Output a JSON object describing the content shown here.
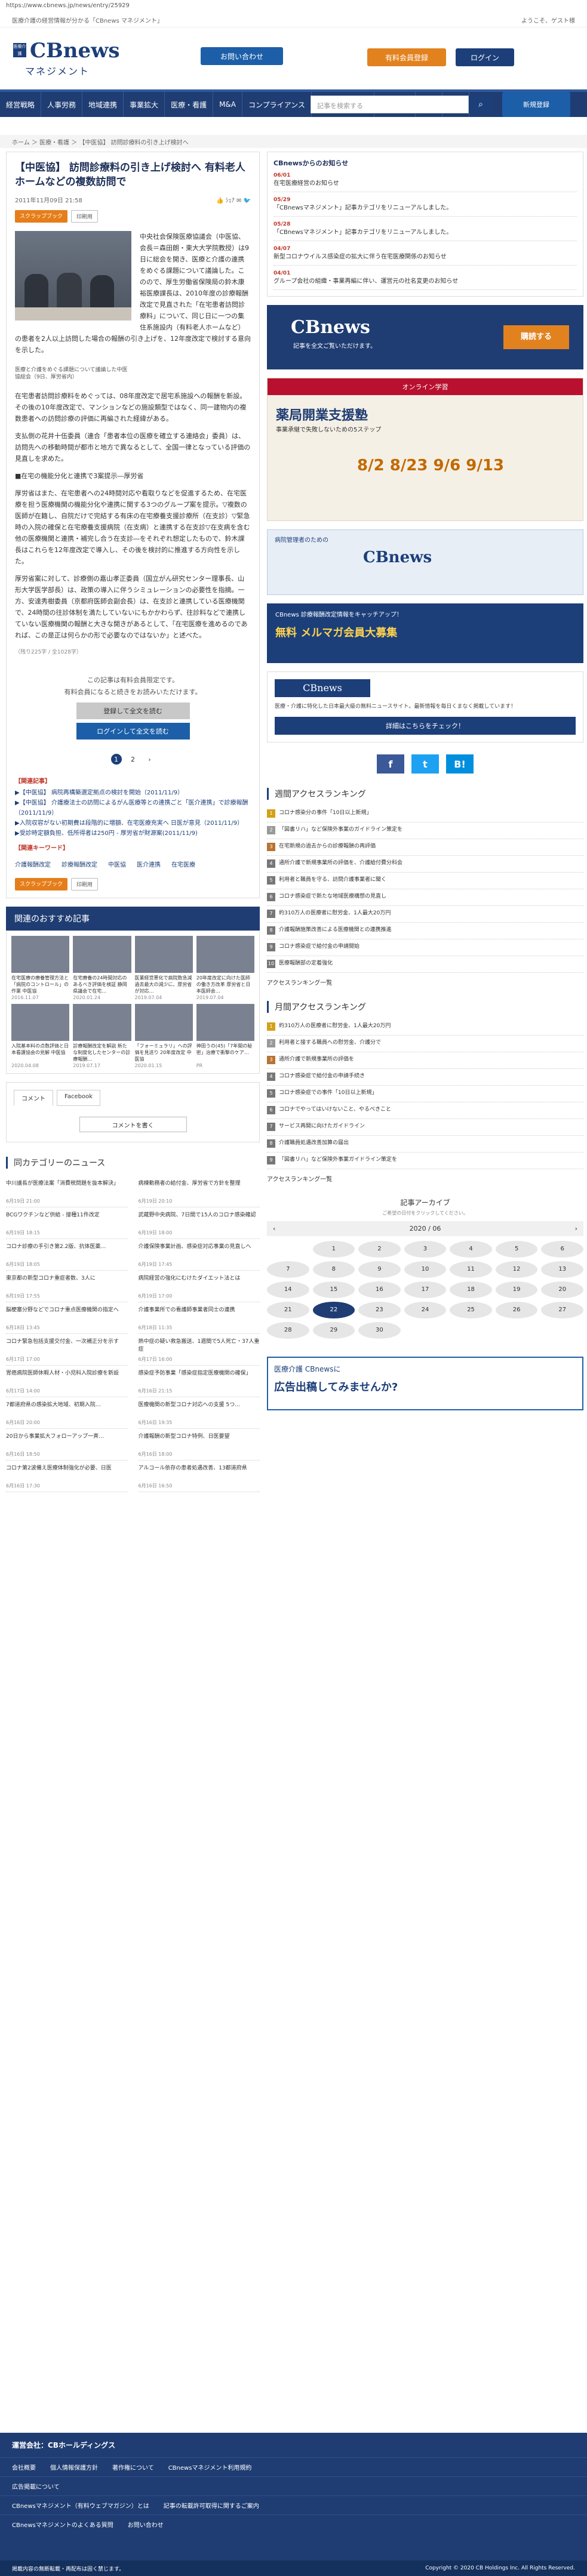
{
  "browser": {
    "url": "https://www.cbnews.jp/news/entry/25929"
  },
  "topstrip": {
    "left": "医療介護の経営情報が分かる「CBnews マネジメント」",
    "right": "ようこそ、ゲスト様"
  },
  "header": {
    "logo_top": "CBnews",
    "logo_bottom": "マネジメント",
    "logo_mark": "医療介護",
    "btn1": "お問い合わせ",
    "btn2": "有料会員登録",
    "btn3": "ログイン"
  },
  "nav": [
    "経営戦略",
    "人事労務",
    "地域連携",
    "事業拡大",
    "医療・看護",
    "M&A",
    "コンプライアンス",
    "イノベーション",
    "世代交代",
    "行政",
    "特集"
  ],
  "search": {
    "placeholder": "記事を検索する",
    "reg_btn": "新規登録"
  },
  "breadcrumb": "ホーム ＞ 医療・看護 ＞ 【中医協】 訪問診療料の引き上げ検討へ",
  "article": {
    "title": "【中医協】 訪問診療料の引き上げ検討へ 有料老人ホームなどの複数訪問で",
    "date": "2011年11月09日 21:58",
    "tag": "スクラップブック",
    "print": "印刷用",
    "caption": "医療と介護をめぐる課題について議論した中医協総会（9日、厚労省内）",
    "p1": "中央社会保険医療協議会（中医協、会長＝森田朗・東大大学院教授）は9日に総会を開き、医療と介護の連携をめぐる課題について議論した。このので、厚生労働省保険局の鈴木康裕医療課長は、2010年度の診療報酬改定で見直された「在宅患者訪問診療料」について、同じ日に一つの集住系施設内（有料老人ホームなど）の患者を2人以上訪問した場合の報酬の引き上げを、12年度改定で検討する意向を示した。",
    "p2": "在宅患者訪問診療料をめぐっては、08年度改定で居宅系施設への報酬を新設。その後の10年度改定で、マンションなどの施設類型ではなく、同一建物内の複数患者への訪問診療の評価に再編された経緯がある。",
    "p3": "支払側の花井十伍委員（連合「患者本位の医療を確立する連絡会」委員）は、訪問先への移動時間が都市と地方で異なるとして、全国一律となっている評価の見直しを求めた。",
    "p4": "■在宅の機能分化と連携で3案提示―厚労省",
    "p5": "厚労省はまた、在宅患者への24時間対応や看取りなどを促進するため、在宅医療を担う医療機関の機能分化や連携に関する3つのグループ案を提示。▽複数の医師が在籍し、自院だけで完結する有床の在宅療養支援診療所（在支診）▽緊急時の入院の確保と在宅療養支援病院（在支病）と連携する在支診▽在支病を含む他の医療機関と連携・補完し合う在支診―をそれぞれ想定したもので、鈴木課長はこれらを12年度改定で導入し、その後を検討的に推進する方向性を示した。",
    "p6": "厚労省案に対して、診療側の嘉山孝正委員（国立がん研究センター理事長、山形大学医学部長）は、政策の導入に伴うシミュレーションの必要性を指摘。一方、安達秀樹委員（京都府医師会副会長）は、在支診と連携している医療機関で、24時間の往診体制を満たしていないにもかかわらず、往診料などで連携していない医療機関の報酬と大きな開きがあるとして、「在宅医療を進めるのであれば、この是正は何らかの形で必要なのではないか」と述べた。",
    "count": "（残り225字 / 全1028字）",
    "lock1": "この記事は有料会員限定です。",
    "lock2": "有料会員になると続きをお読みいただけます。",
    "btn_reg": "登録して全文を読む",
    "btn_login": "ログインして全文を読む",
    "pages": [
      "1",
      "2",
      "›"
    ],
    "related_h": "【関連記事】",
    "related": [
      "▶【中医協】 病院再構築選定拠点の検討を開始（2011/11/9）",
      "▶【中医協】 介護療法士の訪問によるがん医療等との連携ごと「医介連携」で診療報酬（2011/11/9）",
      "▶入院収容がない初期費は段階的に増額、在宅医療充実へ 日医が意見（2011/11/9）",
      "▶受診時定額負担、低所得者は250円 - 厚労省が財源案(2011/11/9)"
    ],
    "kw_h": "【関連キーワード】",
    "keywords": [
      "介護報酬改定",
      "診療報酬改定",
      "中医協",
      "医介連携",
      "在宅医療"
    ]
  },
  "recommend": {
    "title": "関連のおすすめ記事",
    "items": [
      {
        "t": "在宅医療の療養管理方法と「病院のコントロール」の作業 中医協",
        "d": "2016.11.07"
      },
      {
        "t": "在宅療養の24時間対応のあるべき評価を検証 静岡県議会で在宅…",
        "d": "2020.01.24"
      },
      {
        "t": "医業経営悪化で病院数急減 過去最大の減少に、厚労省が対応…",
        "d": "2019.07.04"
      },
      {
        "t": "20年度改定に向けた医師の働き方改革 厚労省と日本医師会…",
        "d": "2019.07.04"
      },
      {
        "t": "入院基本料の点数評価と日本看護協会の見解 中医協",
        "d": "2020.04.08"
      },
      {
        "t": "診療報酬改定を解説 新たな制度化したセンターの診療報酬…",
        "d": "2019.07.17"
      },
      {
        "t": "「フォーミュラリ」への評価を見送り 20年度改定 中医協",
        "d": "2020.01.15"
      },
      {
        "t": "神田うの(45)「7年間の秘密」治療で衝撃のケア…",
        "d": "PR"
      }
    ]
  },
  "comment": {
    "tab1": "コメント",
    "tab2": "Facebook",
    "btn": "コメントを書く"
  },
  "news": {
    "title": "同カテゴリーのニュース",
    "items": [
      {
        "t": "中川議長が医療法案「消費税問題を抜本解決」",
        "d": "6月19日 21:00"
      },
      {
        "t": "病棟勤務者の給付金、厚労省で方針を整理",
        "d": "6月19日 20:10"
      },
      {
        "t": "BCGワクチンなど供給 - 接種11件改定",
        "d": "6月19日 18:15"
      },
      {
        "t": "武蔵野中央病院、7日間で15人のコロナ感染確認",
        "d": "6月19日 18:00"
      },
      {
        "t": "コロナ診療の手引き第2.2版、抗体医薬…",
        "d": "6月19日 18:05"
      },
      {
        "t": "介護保険事業計画、感染症対応事業の見直しへ",
        "d": "6月19日 17:45"
      },
      {
        "t": "東京都の新型コロナ重症者数、3人に",
        "d": "6月19日 17:55"
      },
      {
        "t": "病院経営の強化にむけたダイエット法とは",
        "d": "6月19日 17:00"
      },
      {
        "t": "脳梗塞分野などでコロナ重点医療機関の指定へ",
        "d": "6月18日 13:45"
      },
      {
        "t": "介護事業所での看護師事業者同士の連携",
        "d": "6月18日 11:35"
      },
      {
        "t": "コロナ緊急包括支援交付金、一次補正分を示す",
        "d": "6月17日 17:00"
      },
      {
        "t": "熱中症の疑い救急搬送、1週間で5人死亡・37人重症",
        "d": "6月17日 16:00"
      },
      {
        "t": "胃癌病院医師休暇人材・小児科入院診療を新設",
        "d": "6月17日 14:00"
      },
      {
        "t": "感染症予防事業「感染症指定医療機関の確保」",
        "d": "6月16日 21:15"
      },
      {
        "t": "7都道府県の感染拡大地域、初期入院…",
        "d": "6月16日 20:00"
      },
      {
        "t": "医療機関の新型コロナ対応への支援 5つ…",
        "d": "6月16日 19:35"
      },
      {
        "t": "20日から事業拡大フォローアップ一斉…",
        "d": "6月16日 18:50"
      },
      {
        "t": "介護報酬の新型コロナ特例、日医要望",
        "d": "6月16日 18:00"
      },
      {
        "t": "コロナ第2波備え医療体制強化が必要、日医",
        "d": "6月16日 17:30"
      },
      {
        "t": "アルコール依存の患者処遇改善、13都道府県",
        "d": "6月16日 16:50"
      }
    ]
  },
  "side": {
    "box_title": "CBnewsからのお知らせ",
    "notices": [
      {
        "d": "06/01",
        "t": "在宅医療経営のお知らせ"
      },
      {
        "d": "05/29",
        "t": "「CBnewsマネジメント」記事カテゴリをリニューアルしました。"
      },
      {
        "d": "05/28",
        "t": "「CBnewsマネジメント」記事カテゴリをリニューアルしました。"
      },
      {
        "d": "04/07",
        "t": "新型コロナウイルス感染症の拡大に伴う在宅医療関係のお知らせ"
      },
      {
        "d": "04/01",
        "t": "グループ会社の組織・事業再編に伴い、運営元の社名変更のお知らせ"
      }
    ],
    "banner_top": "CBnews",
    "banner_sub": "記事を全文ご覧いただけます。",
    "banner_btn": "購読する",
    "seminar_top": "オンライン学習",
    "seminar_title": "薬局開業支援塾",
    "seminar_desc": "事業承継で失敗しないための5ステップ",
    "seminar_dates": "8/2 8/23 9/6 9/13",
    "sq_top": "病院管理者のための",
    "sq_logo": "CBnews",
    "mm_top": "CBnews 診療報酬改定情報をキャッチアップ！",
    "mm_main": "無料 メルマガ会員大募集",
    "cb_logo": "CBnews",
    "cb_text": "医療・介護に特化した日本最大級の無料ニュースサイト。最新情報を毎日くまなく掲載しています！",
    "cb_btn": "詳細はこちらをチェック！",
    "social": [
      "f",
      "t",
      "B!"
    ],
    "rank_title": "週間アクセスランキング",
    "rank1": [
      "コロナ感染分の事件「10日以上新規」",
      "「図書リハ」など保険外事業のガイドライン策定を",
      "在宅新規の過去からの診療報酬の再評価",
      "通所介護で新規事業所の評価を、介護給付費分科会",
      "利用者と職員を守る、訪問介護事業者に聞く",
      "コロナ感染症で新たな地域医療構想の見直し",
      "約310万人の医療者に慰労金、1人最大20万円",
      "介護報酬施策改善による医療機関との連携推進",
      "コロナ感染症で給付金の申請開始",
      "医療報酬部の定着強化"
    ],
    "rank_more": "アクセスランキング一覧",
    "rank2_title": "月間アクセスランキング",
    "rank2": [
      "約310万人の医療者に慰労金、1人最大20万円",
      "利用者と接する職員への慰労金、介護分で",
      "通所介護で新規事業所の評価を",
      "コロナ感染症で給付金の申請手続き",
      "コロナ感染症での事件「10日以上新規」",
      "コロナでやってはいけないこと、やるべきこと",
      "サービス再開に向けたガイドライン",
      "介護職員処遇改善加算の届出",
      "「図書リハ」など保険外事業ガイドライン策定を"
    ],
    "archive_title": "記事アーカイブ",
    "archive_sub": "ご希望の日付をクリックしてください。",
    "cal_month": "2020 / 06",
    "cal_days": [
      "",
      "1",
      "2",
      "3",
      "4",
      "5",
      "6",
      "7",
      "8",
      "9",
      "10",
      "11",
      "12",
      "13",
      "14",
      "15",
      "16",
      "17",
      "18",
      "19",
      "20",
      "21",
      "22",
      "23",
      "24",
      "25",
      "26",
      "27",
      "28",
      "29",
      "30",
      "",
      "",
      "",
      ""
    ],
    "adv_top": "医療介護 CBnewsに",
    "adv_main": "広告出稿してみませんか?"
  },
  "footer": {
    "company": "運営会社：CBホールディングス",
    "row1": [
      "会社概要",
      "個人情報保護方針",
      "著作権について",
      "CBnewsマネジメント利用規約"
    ],
    "row2": [
      "広告掲載について"
    ],
    "row3": [
      "CBnewsマネジメント（有料ウェブマガジン）とは",
      "記事の転載許可取得に関するご案内"
    ],
    "row4": [
      "CBnewsマネジメントのよくある質問",
      "お問い合わせ"
    ],
    "bottom_left": "掲載内容の無断転載・再配布は固く禁じます。",
    "bottom_right": "Copyright © 2020 CB Holdings Inc. All Rights Reserved."
  }
}
